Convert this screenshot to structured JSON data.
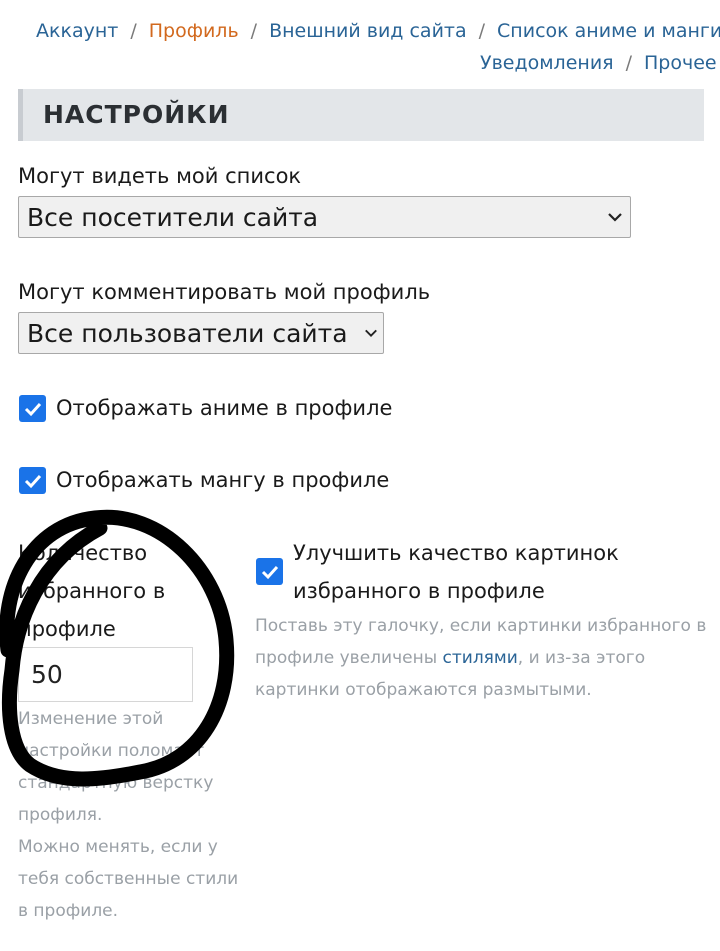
{
  "breadcrumbs": {
    "items": [
      "Аккаунт",
      "Профиль",
      "Внешний вид сайта",
      "Список аниме и манги",
      "Уведомления",
      "Прочее"
    ],
    "separator": "/"
  },
  "section": {
    "title": "НАСТРОЙКИ"
  },
  "list_visibility": {
    "label": "Могут видеть мой список",
    "value": "Все посетители сайта"
  },
  "comment_permission": {
    "label": "Могут комментировать мой профиль",
    "value": "Все пользователи сайта"
  },
  "checkboxes": {
    "show_anime": {
      "label": "Отображать аниме в профиле",
      "checked": true
    },
    "show_manga": {
      "label": "Отображать мангу в профиле",
      "checked": true
    },
    "improve_quality": {
      "label_line1": "Улучшить качество картинок",
      "label_line2": "избранного в профиле",
      "checked": true
    }
  },
  "favorites": {
    "label_line1": "Количество",
    "label_line2": "избранного в",
    "label_line3": "профиле",
    "value": "50",
    "hint_lines": [
      "Изменение этой",
      "настройки поломает",
      "стандартную верстку",
      "профиля.",
      "Можно менять, если у",
      "тебя собственные стили",
      "в профиле."
    ]
  },
  "quality_hint": {
    "line1": "Поставь эту галочку, если картинки избранного в",
    "line2_prefix": "профиле увеличены ",
    "line2_link": "стилями",
    "line2_suffix": ", и из-за этого",
    "line3": "картинки отображаются размытыми."
  },
  "colors": {
    "link": "#2a6496",
    "active_crumb": "#d2691e",
    "checkbox": "#1a73e8",
    "hint": "#9aa0a6",
    "header_bg": "#e3e6e9"
  }
}
